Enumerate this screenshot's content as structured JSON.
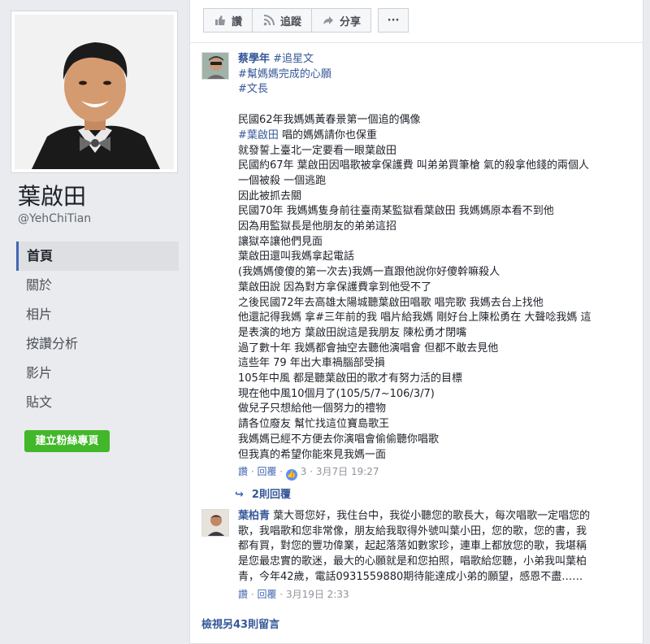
{
  "page": {
    "name": "葉啟田",
    "handle": "@YehChiTian"
  },
  "nav": {
    "items": [
      {
        "label": "首頁",
        "active": true
      },
      {
        "label": "關於"
      },
      {
        "label": "相片"
      },
      {
        "label": "按讚分析"
      },
      {
        "label": "影片"
      },
      {
        "label": "貼文"
      }
    ],
    "create_button": "建立粉絲專頁"
  },
  "actions": {
    "like": "讚",
    "follow": "追蹤",
    "share": "分享",
    "more": "···"
  },
  "comment1": {
    "author": "蔡學年",
    "tags": [
      "#追星文",
      "#幫媽媽完成的心願",
      "#文長"
    ],
    "intro": "民國62年我媽媽黃春景第一個追的偶像",
    "hashtag_line_tag": "#葉啟田",
    "hashtag_line_rest": " 唱的媽媽請你也保重",
    "lines": [
      "就發誓上臺北一定要看一眼葉啟田",
      "民國約67年 葉啟田因唱歌被拿保護費 叫弟弟買筆槍 氣的殺拿他錢的兩個人",
      "一個被殺 一個逃跑",
      "因此被抓去關",
      "民國70年 我媽媽隻身前往臺南某監獄看葉啟田 我媽媽原本看不到他",
      "因為用監獄長是他朋友的弟弟這招",
      "讓獄卒讓他們見面",
      "葉啟田還叫我媽拿起電話",
      "(我媽媽傻傻的第一次去)我媽一直跟他說你好傻幹嘛殺人",
      "葉啟田說 因為對方拿保護費拿到他受不了",
      "之後民國72年去高雄太陽城聽葉啟田唱歌 唱完歌 我媽去台上找他",
      "他還記得我媽 拿#三年前的我 唱片給我媽 剛好台上陳松勇在 大聲唸我媽 這",
      "是表演的地方 葉啟田說這是我朋友 陳松勇才閉嘴",
      "過了數十年 我媽都會抽空去聽他演唱會 但都不敢去見他",
      "這些年 79 年出大車禍腦部受損",
      "105年中風 都是聽葉啟田的歌才有努力活的目標",
      "現在他中風10個月了(105/5/7~106/3/7)",
      "做兒子只想給他一個努力的禮物",
      "請各位廢友 幫忙找這位寶島歌王",
      "我媽媽已經不方便去你演唱會偷偷聽你唱歌",
      "但我真的希望你能來見我媽一面"
    ],
    "meta": {
      "like": "讚",
      "reply": "回覆",
      "reactions": "3",
      "date": "3月7日 19:27"
    },
    "replies": "2則回覆"
  },
  "comment2": {
    "author": "葉柏青",
    "first_line_rest": " 葉大哥您好，我住台中，我從小聽您的歌長大，每次唱歌一定唱您的",
    "lines": [
      "歌，我唱歌和您非常像，朋友給我取得外號叫葉小田，您的歌，您的書，我",
      "都有買，對您的豐功偉業，起起落落如數家珍，連車上都放您的歌，我堪稱",
      "是您最忠實的歌迷，最大的心願就是和您拍照，唱歌給您聽，小弟我叫葉柏",
      "青，今年42歲，電話0931559880期待能達成小弟的願望，感恩不盡……"
    ],
    "meta": {
      "like": "讚",
      "reply": "回覆",
      "date": "3月19日 2:33"
    }
  },
  "more_comments": "檢視另43則留言",
  "colors": {
    "link": "#365899",
    "green": "#42b72a",
    "active_border": "#4267b2"
  }
}
